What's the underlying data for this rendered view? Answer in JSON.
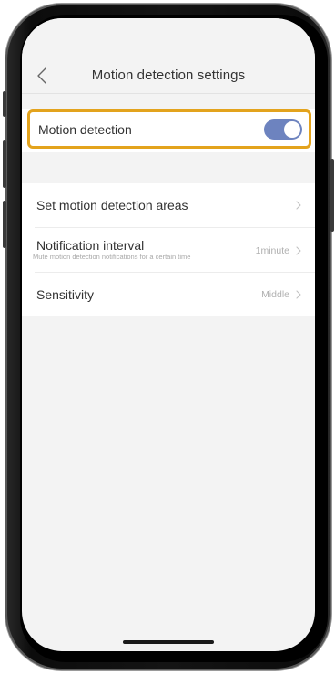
{
  "nav": {
    "title": "Motion detection settings"
  },
  "motion_detection": {
    "label": "Motion detection",
    "enabled": true,
    "toggle_color": "#6d83bf",
    "highlight_color": "#e3a31d"
  },
  "settings": {
    "areas_label": "Set motion detection areas",
    "notification_label": "Notification interval",
    "notification_sub": "Mute motion detection notifications for a certain time",
    "notification_value": "1minute",
    "sensitivity_label": "Sensitivity",
    "sensitivity_value": "Middle"
  },
  "icons": {
    "back": "chevron-left-icon",
    "row_arrow": "chevron-right-icon"
  }
}
